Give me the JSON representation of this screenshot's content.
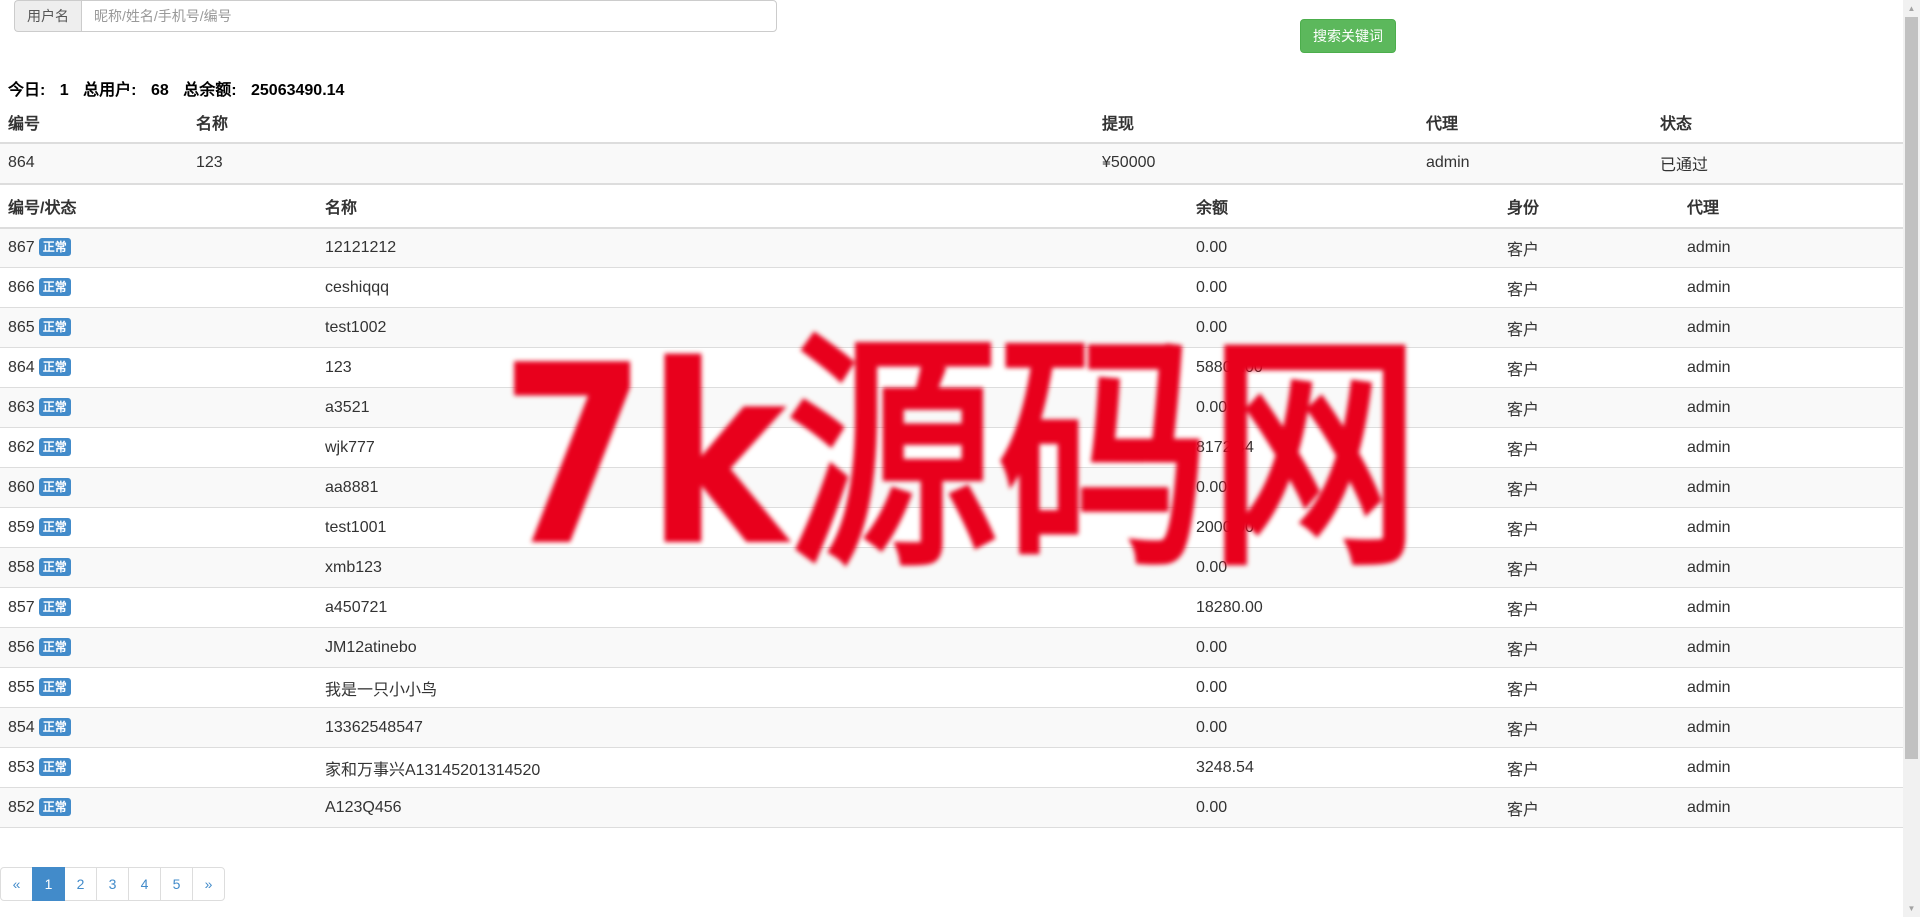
{
  "search": {
    "addon_label": "用户名",
    "placeholder": "昵称/姓名/手机号/编号",
    "value": "",
    "button_label": "搜索关键词"
  },
  "stats": {
    "today_label": "今日:",
    "today_value": "1",
    "users_label": "总用户:",
    "users_value": "68",
    "balance_label": "总余额:",
    "balance_value": "25063490.14"
  },
  "withdraw_table": {
    "headers": [
      "编号",
      "名称",
      "提现",
      "代理",
      "状态"
    ],
    "rows": [
      {
        "id": "864",
        "name": "123",
        "amount": "¥50000",
        "agent": "admin",
        "status": "已通过"
      }
    ]
  },
  "users_table": {
    "headers": [
      "编号/状态",
      "名称",
      "余额",
      "身份",
      "代理"
    ],
    "badge_label": "正常",
    "rows": [
      {
        "id": "867",
        "name": "12121212",
        "balance": "0.00",
        "role": "客户",
        "agent": "admin"
      },
      {
        "id": "866",
        "name": "ceshiqqq",
        "balance": "0.00",
        "role": "客户",
        "agent": "admin"
      },
      {
        "id": "865",
        "name": "test1002",
        "balance": "0.00",
        "role": "客户",
        "agent": "admin"
      },
      {
        "id": "864",
        "name": "123",
        "balance": "58800.00",
        "role": "客户",
        "agent": "admin"
      },
      {
        "id": "863",
        "name": "a3521",
        "balance": "0.00",
        "role": "客户",
        "agent": "admin"
      },
      {
        "id": "862",
        "name": "wjk777",
        "balance": "8172.44",
        "role": "客户",
        "agent": "admin"
      },
      {
        "id": "860",
        "name": "aa8881",
        "balance": "0.00",
        "role": "客户",
        "agent": "admin"
      },
      {
        "id": "859",
        "name": "test1001",
        "balance": "2000.00",
        "role": "客户",
        "agent": "admin"
      },
      {
        "id": "858",
        "name": "xmb123",
        "balance": "0.00",
        "role": "客户",
        "agent": "admin"
      },
      {
        "id": "857",
        "name": "a450721",
        "balance": "18280.00",
        "role": "客户",
        "agent": "admin"
      },
      {
        "id": "856",
        "name": "JM12atinebo",
        "balance": "0.00",
        "role": "客户",
        "agent": "admin"
      },
      {
        "id": "855",
        "name": "我是一只小小鸟",
        "balance": "0.00",
        "role": "客户",
        "agent": "admin"
      },
      {
        "id": "854",
        "name": "13362548547",
        "balance": "0.00",
        "role": "客户",
        "agent": "admin"
      },
      {
        "id": "853",
        "name": "家和万事兴A13145201314520",
        "balance": "3248.54",
        "role": "客户",
        "agent": "admin"
      },
      {
        "id": "852",
        "name": "A123Q456",
        "balance": "0.00",
        "role": "客户",
        "agent": "admin"
      }
    ]
  },
  "pagination": {
    "prev": "«",
    "pages": [
      "1",
      "2",
      "3",
      "4",
      "5"
    ],
    "active": "1",
    "next": "»"
  },
  "watermark": {
    "text": "7k源码网",
    "color": "#e8001c"
  },
  "colors": {
    "success_button": "#5cb85c",
    "primary": "#428bca",
    "stripe": "#f9f9f9",
    "border": "#dddddd"
  }
}
